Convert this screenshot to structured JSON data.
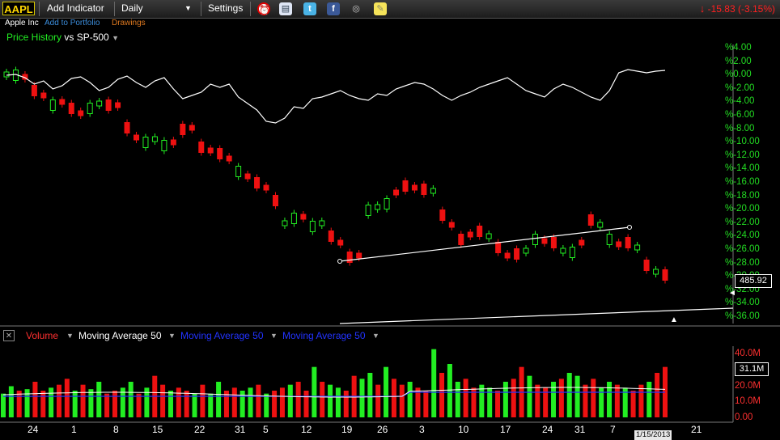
{
  "toolbar": {
    "symbol": "AAPL",
    "add_indicator": "Add Indicator",
    "interval": "Daily",
    "settings": "Settings",
    "change": "-15.83 (-3.15%)"
  },
  "subheader": {
    "company": "Apple Inc",
    "add_portfolio": "Add to Portfolio",
    "drawings": "Drawings"
  },
  "price_pane": {
    "title": "Price History",
    "compare": "vs SP-500",
    "last_price": "485.92",
    "right_labels": [
      "%4.00",
      "%2.00",
      "%0.00",
      "%-2.00",
      "%-4.00",
      "%-6.00",
      "%-8.00",
      "%-10.00",
      "%-12.00",
      "%-14.00",
      "%-16.00",
      "%-18.00",
      "%-20.00",
      "%-22.00",
      "%-24.00",
      "%-26.00",
      "%-28.00",
      "%-30.00",
      "%-32.00",
      "%-34.00",
      "%-36.00"
    ]
  },
  "volume_pane": {
    "volume": "Volume",
    "ma1": "Moving Average 50",
    "ma2": "Moving Average 50",
    "ma3": "Moving Average 50",
    "labels": [
      "40.0M",
      "20.0M",
      "10.0M",
      "0.00"
    ],
    "current": "31.1M"
  },
  "x_axis": {
    "ticks": [
      "24",
      "1",
      "8",
      "15",
      "22",
      "31",
      "5",
      "12",
      "19",
      "26",
      "3",
      "10",
      "17",
      "24",
      "31",
      "7",
      "21"
    ],
    "date_tag": "1/15/2013"
  },
  "colors": {
    "up": "#22ee22",
    "down": "#ee1111",
    "line": "#ffffff",
    "accent": "#ffd700"
  },
  "chart_data": {
    "type": "candlestick",
    "up_down_sequence": [
      "up",
      "up",
      "down",
      "down",
      "down",
      "up",
      "down",
      "down",
      "down",
      "up",
      "up",
      "down",
      "down",
      "down",
      "down",
      "up",
      "up",
      "up",
      "down",
      "down",
      "down",
      "down",
      "down",
      "down",
      "down",
      "up",
      "down",
      "down",
      "down",
      "down",
      "up",
      "up",
      "down",
      "up",
      "up",
      "down",
      "down",
      "down",
      "down",
      "up",
      "up",
      "up",
      "down",
      "down",
      "down",
      "down",
      "up",
      "down",
      "down",
      "down",
      "down",
      "down",
      "up",
      "down",
      "down",
      "down",
      "up",
      "up",
      "down",
      "down",
      "up",
      "up",
      "down",
      "down",
      "up",
      "up",
      "down",
      "down",
      "up",
      "down",
      "up",
      "down"
    ],
    "volume_values_m": [
      16,
      21,
      18,
      19,
      24,
      18,
      20,
      22,
      26,
      18,
      22,
      19,
      24,
      16,
      18,
      20,
      24,
      16,
      20,
      28,
      22,
      18,
      20,
      18,
      16,
      22,
      16,
      24,
      18,
      20,
      18,
      20,
      22,
      16,
      18,
      20,
      22,
      24,
      18,
      34,
      24,
      22,
      20,
      18,
      28,
      26,
      30,
      22,
      34,
      26,
      22,
      24,
      20,
      18,
      46,
      30,
      36,
      24,
      26,
      20,
      22,
      20,
      18,
      24,
      26,
      34,
      28,
      22,
      20,
      24,
      26,
      30,
      28,
      22,
      26,
      20,
      24,
      22,
      20,
      18,
      22,
      24,
      30,
      34
    ]
  }
}
